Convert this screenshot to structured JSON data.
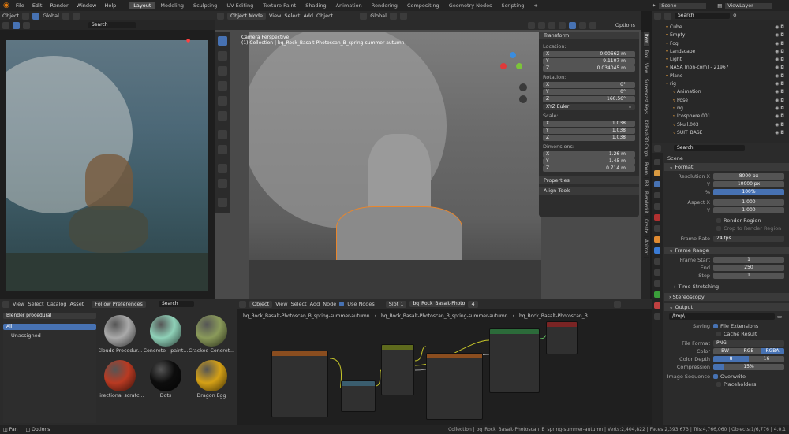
{
  "topbar": {
    "menus": [
      "File",
      "Edit",
      "Render",
      "Window",
      "Help"
    ],
    "workspaces": [
      "Layout",
      "Modeling",
      "Sculpting",
      "UV Editing",
      "Texture Paint",
      "Shading",
      "Animation",
      "Rendering",
      "Compositing",
      "Geometry Nodes",
      "Scripting"
    ],
    "active_workspace": "Layout",
    "scene": "Scene",
    "view_layer": "ViewLayer"
  },
  "image_editor": {
    "mode": "Object",
    "orientation": "Global",
    "search_placeholder": "Search"
  },
  "viewport": {
    "mode": "Object Mode",
    "menus": [
      "View",
      "Select",
      "Add",
      "Object"
    ],
    "orientation": "Global",
    "options": "Options",
    "overlay_title": "Camera Perspective",
    "overlay_sub": "(1) Collection | bq_Rock_Basalt-Photoscan_B_spring-summer-autumn"
  },
  "npanel": {
    "tabs": [
      "Item",
      "Tool",
      "View",
      "Screencast Keys",
      "KitBash3D Cargo",
      "Boom",
      "BR",
      "Blenderkit",
      "Create",
      "Animat"
    ],
    "title": "Transform",
    "location_label": "Location:",
    "location": [
      {
        "axis": "X",
        "value": "-0.00662 m"
      },
      {
        "axis": "Y",
        "value": "9.1107 m"
      },
      {
        "axis": "Z",
        "value": "0.034045 m"
      }
    ],
    "rotation_label": "Rotation:",
    "rotation": [
      {
        "axis": "X",
        "value": "0°"
      },
      {
        "axis": "Y",
        "value": "0°"
      },
      {
        "axis": "Z",
        "value": "160.56°"
      }
    ],
    "rotation_mode": "XYZ Euler",
    "scale_label": "Scale:",
    "scale": [
      {
        "axis": "X",
        "value": "1.038"
      },
      {
        "axis": "Y",
        "value": "1.038"
      },
      {
        "axis": "Z",
        "value": "1.038"
      }
    ],
    "dimensions_label": "Dimensions:",
    "dimensions": [
      {
        "axis": "X",
        "value": "1.26 m"
      },
      {
        "axis": "Y",
        "value": "1.45 m"
      },
      {
        "axis": "Z",
        "value": "0.714 m"
      }
    ],
    "properties": "Properties",
    "align_tools": "Align Tools"
  },
  "outliner": {
    "search_placeholder": "Search",
    "items": [
      {
        "name": "Cube",
        "indent": 2
      },
      {
        "name": "Empty",
        "indent": 2
      },
      {
        "name": "Fog",
        "indent": 2
      },
      {
        "name": "Landscape",
        "indent": 2
      },
      {
        "name": "Light",
        "indent": 2
      },
      {
        "name": "NASA (non-com) - 21967",
        "indent": 2
      },
      {
        "name": "Plane",
        "indent": 2
      },
      {
        "name": "rig",
        "indent": 2
      },
      {
        "name": "Animation",
        "indent": 3
      },
      {
        "name": "Pose",
        "indent": 3
      },
      {
        "name": "rig",
        "indent": 3
      },
      {
        "name": "Icosphere.001",
        "indent": 3
      },
      {
        "name": "Skull.003",
        "indent": 3
      },
      {
        "name": "SUIT_BASE",
        "indent": 3
      }
    ]
  },
  "properties": {
    "search_placeholder": "Search",
    "scene_label": "Scene",
    "format": {
      "title": "Format",
      "resolution_x_label": "Resolution X",
      "resolution_x": "8000 px",
      "y_label": "Y",
      "resolution_y": "10000 px",
      "pct_label": "%",
      "percentage": "100%",
      "aspect_x_label": "Aspect X",
      "aspect_x": "1.000",
      "aspect_y_label": "Y",
      "aspect_y": "1.000",
      "render_region": "Render Region",
      "crop": "Crop to Render Region",
      "frame_rate_label": "Frame Rate",
      "frame_rate": "24 fps"
    },
    "frame_range": {
      "title": "Frame Range",
      "start_label": "Frame Start",
      "start": "1",
      "end_label": "End",
      "end": "250",
      "step_label": "Step",
      "step": "1"
    },
    "time_stretching": "Time Stretching",
    "stereoscopy": "Stereoscopy",
    "output": {
      "title": "Output",
      "path": "/tmp\\",
      "saving_label": "Saving",
      "file_extensions": "File Extensions",
      "cache_result": "Cache Result",
      "file_format_label": "File Format",
      "file_format": "PNG",
      "color_label": "Color",
      "color_options": [
        "BW",
        "RGB",
        "RGBA"
      ],
      "color_depth_label": "Color Depth",
      "depth_options": [
        "8",
        "16"
      ],
      "compression_label": "Compression",
      "compression": "15%",
      "image_sequence_label": "Image Sequence",
      "overwrite": "Overwrite",
      "placeholders": "Placeholders"
    }
  },
  "asset_browser": {
    "menus": [
      "View",
      "Select",
      "Catalog",
      "Asset"
    ],
    "preferences": "Follow Preferences",
    "search_placeholder": "Search",
    "library": "Blender procedural",
    "catalogs": [
      {
        "name": "All",
        "active": true
      },
      {
        "name": "Unassigned",
        "active": false
      }
    ],
    "assets": [
      {
        "name": "Clouds Procedur...",
        "color": "#aaaaaa"
      },
      {
        "name": "Concrete - paint...",
        "color": "#8fd1b8"
      },
      {
        "name": "Cracked Concret...",
        "color": "#8a9a5a"
      },
      {
        "name": "Directional scratc...",
        "color": "#b93a22"
      },
      {
        "name": "Dots",
        "color": "#0d0d0d"
      },
      {
        "name": "Dragon Egg",
        "color": "#d4a016"
      }
    ]
  },
  "node_editor": {
    "type": "Object",
    "menus": [
      "View",
      "Select",
      "Add",
      "Node"
    ],
    "use_nodes": "Use Nodes",
    "slot": "Slot 1",
    "material": "bq_Rock_Basalt-Photoscan_B_spring-summer-autumn",
    "count": "4",
    "breadcrumbs": [
      "bq_Rock_Basalt-Photoscan_B_spring-summer-autumn",
      "bq_Rock_Basalt-Photoscan_B_spring-summer-autumn",
      "bq_Rock_Basalt-Photoscan_B"
    ]
  },
  "statusbar": {
    "left": [
      "Pan",
      "Options"
    ],
    "stats": "Collection | bq_Rock_Basalt-Photoscan_B_spring-summer-autumn | Verts:2,404,822 | Faces:2,393,673 | Tris:4,766,060 | Objects:1/6,776 | 4.0.1"
  }
}
